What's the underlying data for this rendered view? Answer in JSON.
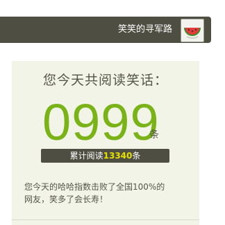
{
  "user": {
    "name": "笑笑的寻军路",
    "avatar_icon": "watermelon-icon"
  },
  "stats": {
    "headline": "您今天共阅读笑话：",
    "today_count": "0999",
    "count_unit": "条",
    "total_prefix": "累计阅读",
    "total_value": "13340",
    "total_suffix": "条",
    "description_line1": "您今天的哈哈指数击败了全国100%的",
    "description_line2": "网友，笑多了会长寿！"
  },
  "colors": {
    "accent_green": "#7ab317",
    "dark_bar": "#4e4e43",
    "highlight_yellow": "#e8e000",
    "panel_bg": "#f2f4e8"
  }
}
